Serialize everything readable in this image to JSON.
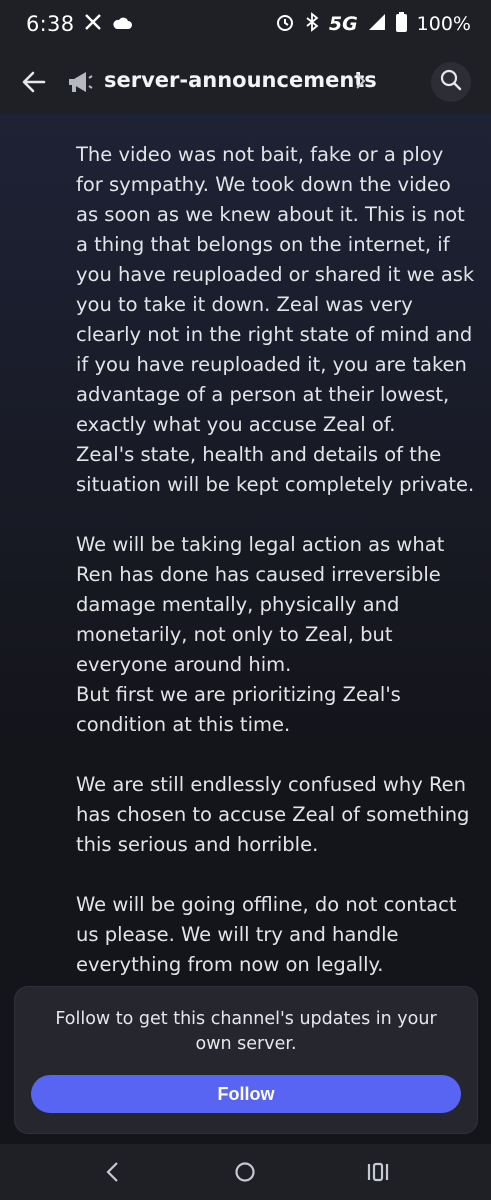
{
  "status_bar": {
    "time": "6:38",
    "network": "5G",
    "battery": "100%",
    "icons": [
      "x-logo-icon",
      "cloud-icon",
      "alarm-icon",
      "bluetooth-icon",
      "signal-icon",
      "battery-icon"
    ]
  },
  "header": {
    "channel_name": "server-announcements",
    "icons": [
      "back-arrow-icon",
      "announcement-icon",
      "chevron-right-icon",
      "search-icon"
    ]
  },
  "message": {
    "paragraphs": [
      [
        "The video was not bait, fake or a ploy for sympathy. We took down the video as soon as we knew about it. This is not a thing that belongs on the internet, if you have reuploaded or shared it we ask you to take it down. Zeal was very clearly not in the right state of mind and if you have reuploaded it, you are taken advantage of a person at their lowest, exactly what you accuse Zeal of.",
        "Zeal's state, health and details of the situation will be kept completely private."
      ],
      [
        "We will be taking legal action as what Ren has done has caused irreversible damage mentally, physically and monetarily, not only to Zeal, but everyone around him.",
        "But first we are prioritizing Zeal's condition at this time."
      ],
      [
        "We are still endlessly confused why Ren has chosen to accuse Zeal of something this serious and horrible."
      ],
      [
        "We will be going offline, do not contact us please. We will try and handle everything from now on legally."
      ]
    ]
  },
  "follow_card": {
    "text": "Follow to get this channel's updates in your own server.",
    "button_label": "Follow",
    "accent_color": "#5865f2"
  },
  "nav_bar": {
    "icons": [
      "nav-back-icon",
      "nav-home-icon",
      "nav-recents-icon"
    ]
  }
}
